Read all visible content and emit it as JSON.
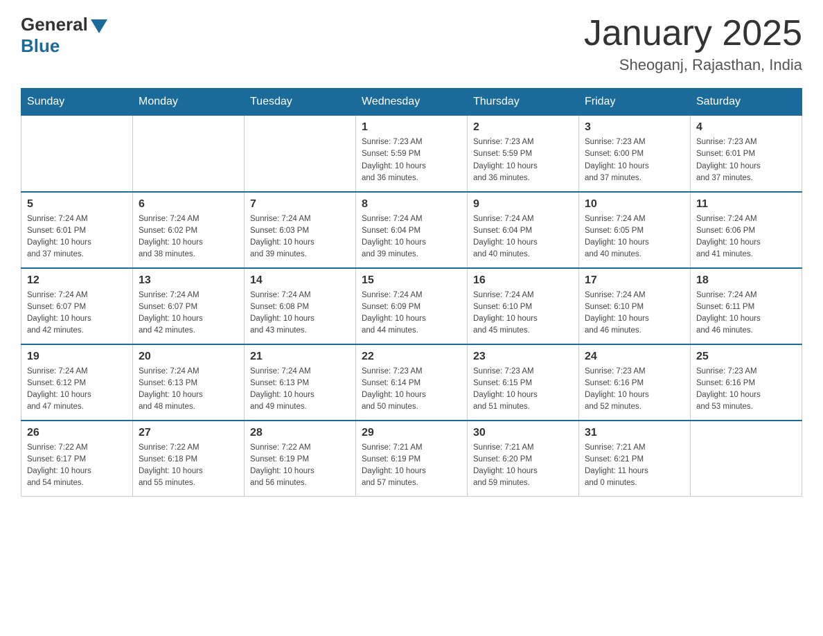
{
  "logo": {
    "text_general": "General",
    "text_blue": "Blue"
  },
  "title": "January 2025",
  "subtitle": "Sheoganj, Rajasthan, India",
  "days_of_week": [
    "Sunday",
    "Monday",
    "Tuesday",
    "Wednesday",
    "Thursday",
    "Friday",
    "Saturday"
  ],
  "weeks": [
    [
      {
        "day": "",
        "info": ""
      },
      {
        "day": "",
        "info": ""
      },
      {
        "day": "",
        "info": ""
      },
      {
        "day": "1",
        "info": "Sunrise: 7:23 AM\nSunset: 5:59 PM\nDaylight: 10 hours\nand 36 minutes."
      },
      {
        "day": "2",
        "info": "Sunrise: 7:23 AM\nSunset: 5:59 PM\nDaylight: 10 hours\nand 36 minutes."
      },
      {
        "day": "3",
        "info": "Sunrise: 7:23 AM\nSunset: 6:00 PM\nDaylight: 10 hours\nand 37 minutes."
      },
      {
        "day": "4",
        "info": "Sunrise: 7:23 AM\nSunset: 6:01 PM\nDaylight: 10 hours\nand 37 minutes."
      }
    ],
    [
      {
        "day": "5",
        "info": "Sunrise: 7:24 AM\nSunset: 6:01 PM\nDaylight: 10 hours\nand 37 minutes."
      },
      {
        "day": "6",
        "info": "Sunrise: 7:24 AM\nSunset: 6:02 PM\nDaylight: 10 hours\nand 38 minutes."
      },
      {
        "day": "7",
        "info": "Sunrise: 7:24 AM\nSunset: 6:03 PM\nDaylight: 10 hours\nand 39 minutes."
      },
      {
        "day": "8",
        "info": "Sunrise: 7:24 AM\nSunset: 6:04 PM\nDaylight: 10 hours\nand 39 minutes."
      },
      {
        "day": "9",
        "info": "Sunrise: 7:24 AM\nSunset: 6:04 PM\nDaylight: 10 hours\nand 40 minutes."
      },
      {
        "day": "10",
        "info": "Sunrise: 7:24 AM\nSunset: 6:05 PM\nDaylight: 10 hours\nand 40 minutes."
      },
      {
        "day": "11",
        "info": "Sunrise: 7:24 AM\nSunset: 6:06 PM\nDaylight: 10 hours\nand 41 minutes."
      }
    ],
    [
      {
        "day": "12",
        "info": "Sunrise: 7:24 AM\nSunset: 6:07 PM\nDaylight: 10 hours\nand 42 minutes."
      },
      {
        "day": "13",
        "info": "Sunrise: 7:24 AM\nSunset: 6:07 PM\nDaylight: 10 hours\nand 42 minutes."
      },
      {
        "day": "14",
        "info": "Sunrise: 7:24 AM\nSunset: 6:08 PM\nDaylight: 10 hours\nand 43 minutes."
      },
      {
        "day": "15",
        "info": "Sunrise: 7:24 AM\nSunset: 6:09 PM\nDaylight: 10 hours\nand 44 minutes."
      },
      {
        "day": "16",
        "info": "Sunrise: 7:24 AM\nSunset: 6:10 PM\nDaylight: 10 hours\nand 45 minutes."
      },
      {
        "day": "17",
        "info": "Sunrise: 7:24 AM\nSunset: 6:10 PM\nDaylight: 10 hours\nand 46 minutes."
      },
      {
        "day": "18",
        "info": "Sunrise: 7:24 AM\nSunset: 6:11 PM\nDaylight: 10 hours\nand 46 minutes."
      }
    ],
    [
      {
        "day": "19",
        "info": "Sunrise: 7:24 AM\nSunset: 6:12 PM\nDaylight: 10 hours\nand 47 minutes."
      },
      {
        "day": "20",
        "info": "Sunrise: 7:24 AM\nSunset: 6:13 PM\nDaylight: 10 hours\nand 48 minutes."
      },
      {
        "day": "21",
        "info": "Sunrise: 7:24 AM\nSunset: 6:13 PM\nDaylight: 10 hours\nand 49 minutes."
      },
      {
        "day": "22",
        "info": "Sunrise: 7:23 AM\nSunset: 6:14 PM\nDaylight: 10 hours\nand 50 minutes."
      },
      {
        "day": "23",
        "info": "Sunrise: 7:23 AM\nSunset: 6:15 PM\nDaylight: 10 hours\nand 51 minutes."
      },
      {
        "day": "24",
        "info": "Sunrise: 7:23 AM\nSunset: 6:16 PM\nDaylight: 10 hours\nand 52 minutes."
      },
      {
        "day": "25",
        "info": "Sunrise: 7:23 AM\nSunset: 6:16 PM\nDaylight: 10 hours\nand 53 minutes."
      }
    ],
    [
      {
        "day": "26",
        "info": "Sunrise: 7:22 AM\nSunset: 6:17 PM\nDaylight: 10 hours\nand 54 minutes."
      },
      {
        "day": "27",
        "info": "Sunrise: 7:22 AM\nSunset: 6:18 PM\nDaylight: 10 hours\nand 55 minutes."
      },
      {
        "day": "28",
        "info": "Sunrise: 7:22 AM\nSunset: 6:19 PM\nDaylight: 10 hours\nand 56 minutes."
      },
      {
        "day": "29",
        "info": "Sunrise: 7:21 AM\nSunset: 6:19 PM\nDaylight: 10 hours\nand 57 minutes."
      },
      {
        "day": "30",
        "info": "Sunrise: 7:21 AM\nSunset: 6:20 PM\nDaylight: 10 hours\nand 59 minutes."
      },
      {
        "day": "31",
        "info": "Sunrise: 7:21 AM\nSunset: 6:21 PM\nDaylight: 11 hours\nand 0 minutes."
      },
      {
        "day": "",
        "info": ""
      }
    ]
  ]
}
